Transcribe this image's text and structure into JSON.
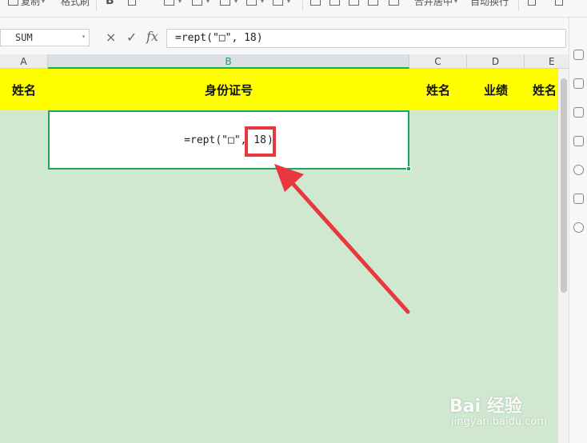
{
  "ribbon": {
    "copy_label": "复制",
    "format_painter_label": "格式刷",
    "bold_label": "B",
    "merge_center_label": "合并居中",
    "wrap_text_label": "自动换行"
  },
  "formula_bar": {
    "name_box": "SUM",
    "cancel_symbol": "×",
    "confirm_symbol": "✓",
    "fx_label": "fx",
    "formula": "=rept(\"□\", 18)"
  },
  "columns": [
    "A",
    "B",
    "C",
    "D",
    "E"
  ],
  "header_row": {
    "a": "姓名",
    "b": "身份证号",
    "c": "姓名",
    "d": "业绩",
    "e": "姓名"
  },
  "selected_cell": {
    "ref": "B2",
    "prefix": "=rept(\"□\", ",
    "highlight": "18",
    "suffix": ")"
  },
  "colors": {
    "header_fill": "#ffff00",
    "body_fill": "#cfe8cf",
    "selection_border": "#21a366",
    "annotation_red": "#e8383d"
  },
  "watermark": {
    "title": "Bai 经验",
    "subtitle": "jingyan.baidu.com"
  }
}
